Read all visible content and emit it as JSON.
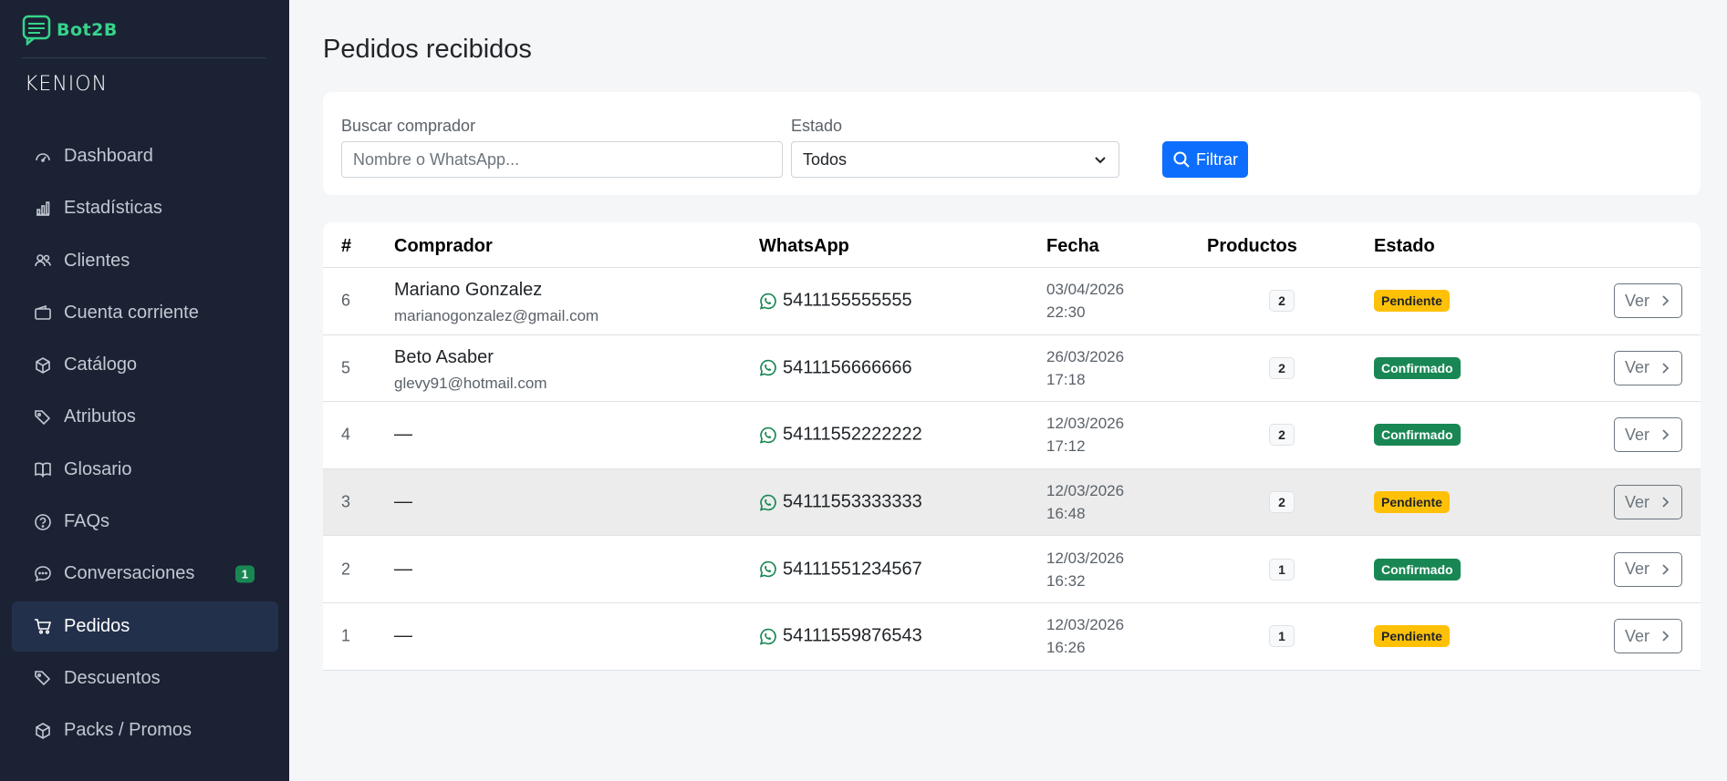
{
  "brand": {
    "name": "Bot2B",
    "tenant": "KENION",
    "accent": "#35d48a"
  },
  "sidebar": {
    "items": [
      {
        "label": "Dashboard",
        "icon": "speedometer-icon"
      },
      {
        "label": "Estadísticas",
        "icon": "bar-chart-icon"
      },
      {
        "label": "Clientes",
        "icon": "people-icon"
      },
      {
        "label": "Cuenta corriente",
        "icon": "wallet-icon"
      },
      {
        "label": "Catálogo",
        "icon": "box-icon"
      },
      {
        "label": "Atributos",
        "icon": "tags-icon"
      },
      {
        "label": "Glosario",
        "icon": "book-icon"
      },
      {
        "label": "FAQs",
        "icon": "question-circle-icon"
      },
      {
        "label": "Conversaciones",
        "icon": "chat-dots-icon",
        "badge": "1"
      },
      {
        "label": "Pedidos",
        "icon": "cart-icon",
        "active": true
      },
      {
        "label": "Descuentos",
        "icon": "tag-icon"
      },
      {
        "label": "Packs / Promos",
        "icon": "box-icon"
      }
    ]
  },
  "page": {
    "title": "Pedidos recibidos"
  },
  "filters": {
    "search_label": "Buscar comprador",
    "search_placeholder": "Nombre o WhatsApp...",
    "search_value": "",
    "status_label": "Estado",
    "status_value": "Todos",
    "filter_button": "Filtrar"
  },
  "table": {
    "headers": {
      "num": "#",
      "buyer": "Comprador",
      "whatsapp": "WhatsApp",
      "date": "Fecha",
      "products": "Productos",
      "status": "Estado"
    },
    "view_label": "Ver",
    "rows": [
      {
        "num": "6",
        "name": "Mariano Gonzalez",
        "email": "marianogonzalez@gmail.com",
        "whatsapp": "5411155555555",
        "date": "03/04/2026",
        "time": "22:30",
        "products": "2",
        "status": "Pendiente"
      },
      {
        "num": "5",
        "name": "Beto Asaber",
        "email": "glevy91@hotmail.com",
        "whatsapp": "5411156666666",
        "date": "26/03/2026",
        "time": "17:18",
        "products": "2",
        "status": "Confirmado"
      },
      {
        "num": "4",
        "name": "—",
        "email": "",
        "whatsapp": "54111552222222",
        "date": "12/03/2026",
        "time": "17:12",
        "products": "2",
        "status": "Confirmado"
      },
      {
        "num": "3",
        "name": "—",
        "email": "",
        "whatsapp": "54111553333333",
        "date": "12/03/2026",
        "time": "16:48",
        "products": "2",
        "status": "Pendiente"
      },
      {
        "num": "2",
        "name": "—",
        "email": "",
        "whatsapp": "54111551234567",
        "date": "12/03/2026",
        "time": "16:32",
        "products": "1",
        "status": "Confirmado"
      },
      {
        "num": "1",
        "name": "—",
        "email": "",
        "whatsapp": "54111559876543",
        "date": "12/03/2026",
        "time": "16:26",
        "products": "1",
        "status": "Pendiente"
      }
    ]
  },
  "colors": {
    "pending": "#ffc107",
    "confirmed": "#198754",
    "primary": "#0d6efd",
    "whatsapp": "#198754"
  }
}
